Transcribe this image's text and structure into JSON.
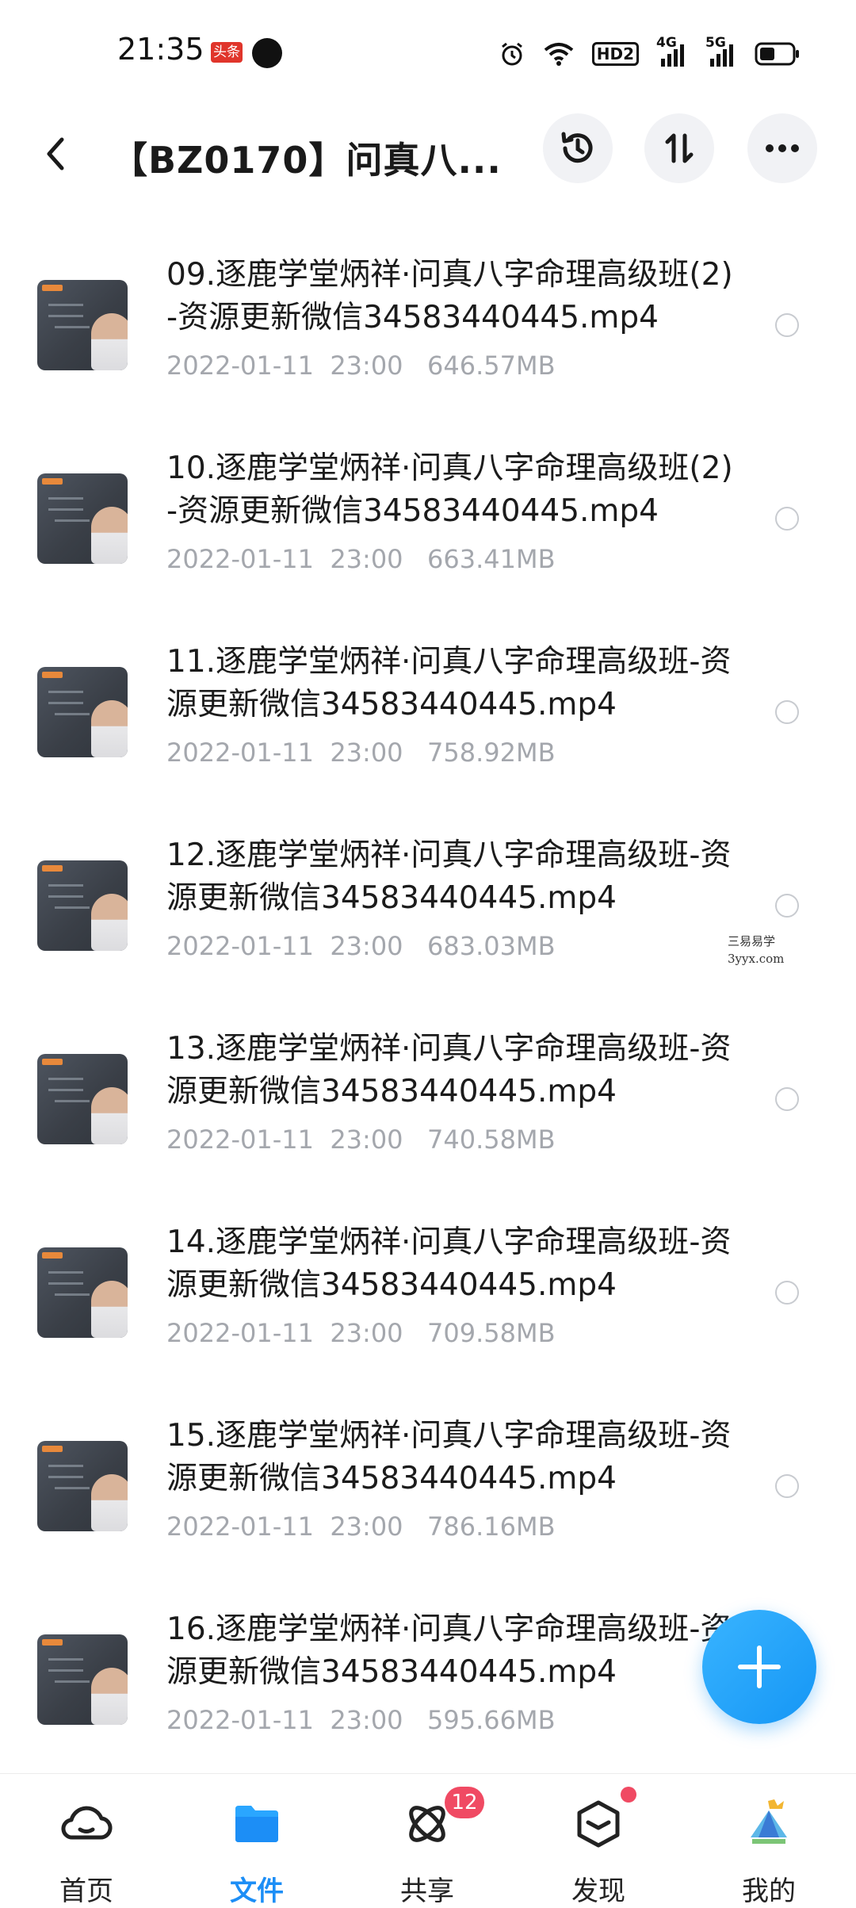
{
  "status_bar": {
    "time": "21:35",
    "app_tag": "头条",
    "network_tags": [
      "HD2",
      "4G",
      "5G"
    ],
    "icons": [
      "alarm-icon",
      "wifi-icon",
      "signal-icon",
      "signal-icon",
      "battery-icon"
    ]
  },
  "header": {
    "title": "【BZ0170】问真八...",
    "back_icon": "chevron-left-icon",
    "actions": [
      "history-icon",
      "sort-icon",
      "more-icon"
    ]
  },
  "files": [
    {
      "name": "09.逐鹿学堂炳祥·问真八字命理高级班(2)-资源更新微信34583440445.mp4",
      "date": "2022-01-11",
      "time": "23:00",
      "size": "646.57MB"
    },
    {
      "name": "10.逐鹿学堂炳祥·问真八字命理高级班(2)-资源更新微信34583440445.mp4",
      "date": "2022-01-11",
      "time": "23:00",
      "size": "663.41MB"
    },
    {
      "name": "11.逐鹿学堂炳祥·问真八字命理高级班-资源更新微信34583440445.mp4",
      "date": "2022-01-11",
      "time": "23:00",
      "size": "758.92MB"
    },
    {
      "name": "12.逐鹿学堂炳祥·问真八字命理高级班-资源更新微信34583440445.mp4",
      "date": "2022-01-11",
      "time": "23:00",
      "size": "683.03MB"
    },
    {
      "name": "13.逐鹿学堂炳祥·问真八字命理高级班-资源更新微信34583440445.mp4",
      "date": "2022-01-11",
      "time": "23:00",
      "size": "740.58MB"
    },
    {
      "name": "14.逐鹿学堂炳祥·问真八字命理高级班-资源更新微信34583440445.mp4",
      "date": "2022-01-11",
      "time": "23:00",
      "size": "709.58MB"
    },
    {
      "name": "15.逐鹿学堂炳祥·问真八字命理高级班-资源更新微信34583440445.mp4",
      "date": "2022-01-11",
      "time": "23:00",
      "size": "786.16MB"
    },
    {
      "name": "16.逐鹿学堂炳祥·问真八字命理高级班-资源更新微信34583440445.mp4",
      "date": "2022-01-11",
      "time": "23:00",
      "size": "595.66MB"
    }
  ],
  "watermark": {
    "line1": "三易易学",
    "line2": "3yyx.com"
  },
  "fab": {
    "icon": "plus-icon"
  },
  "nav": [
    {
      "label": "首页",
      "icon": "cloud-icon",
      "active": false
    },
    {
      "label": "文件",
      "icon": "folder-icon",
      "active": true
    },
    {
      "label": "共享",
      "icon": "orbit-icon",
      "active": false,
      "badge": "12"
    },
    {
      "label": "发现",
      "icon": "cube-icon",
      "active": false,
      "dot": true
    },
    {
      "label": "我的",
      "icon": "avatar-icon",
      "active": false
    }
  ],
  "colors": {
    "accent": "#1c8ef6",
    "badge": "#f04a63",
    "meta_text": "#a4a7ad"
  }
}
